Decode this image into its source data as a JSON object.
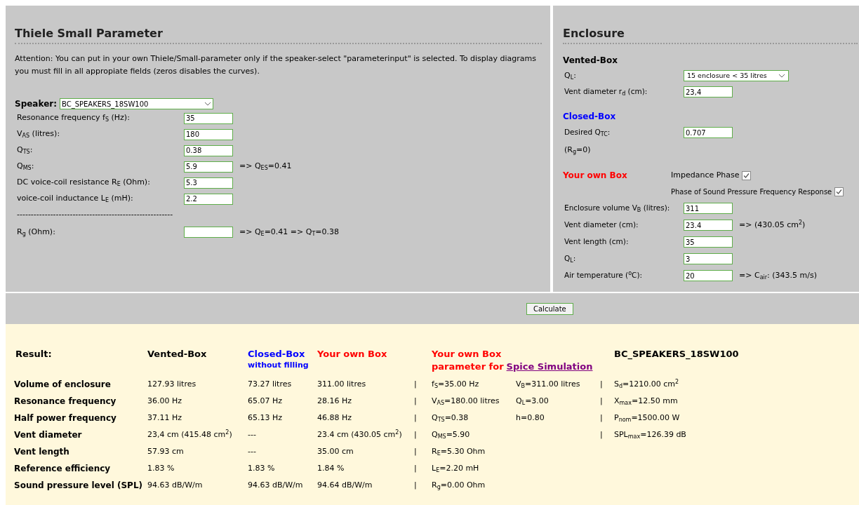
{
  "parameters": {
    "title": "Thiele Small Parameter",
    "notice": "Attention: You can put in your own Thiele/Small-parameter only if the speaker-select \"parameterinput\" is selected. To display diagrams you must fill in all appropiate fields (zeros disables the curves).",
    "speaker": {
      "label": "Speaker:",
      "value": "BC_SPEAKERS_18SW100"
    },
    "fields": [
      {
        "kind": "field",
        "label": "Resonance frequency f$_{S}$ (Hz):",
        "value": "35"
      },
      {
        "kind": "field",
        "label": "V$_{AS}$ (litres):",
        "value": "180"
      },
      {
        "kind": "field",
        "label": "Q$_{TS}$:",
        "value": "0.38"
      },
      {
        "kind": "field",
        "label": "Q$_{MS}$:",
        "value": "5.9",
        "note": "=> Q$_{ES}$=0.41"
      },
      {
        "kind": "field",
        "label": "DC voice-coil resistance R$_{E}$ (Ohm):",
        "value": "5.3"
      },
      {
        "kind": "field",
        "label": "voice-coil inductance L$_{E}$ (mH):",
        "value": "2.2"
      },
      {
        "kind": "divider",
        "text": "--------------------------------------------------------"
      },
      {
        "kind": "field",
        "label": "R$_{g}$ (Ohm):",
        "note": "=> Q$_{E}$=0.41 => Q$_{T}$=0.38"
      }
    ]
  },
  "enclosure": {
    "title": "Enclosure",
    "items": [
      {
        "kind": "heading",
        "text": "Vented-Box",
        "color": "#000000"
      },
      {
        "kind": "select",
        "label": "Q$_{L}$:",
        "value": "15 enclosure < 35 litres"
      },
      {
        "kind": "field",
        "label": "Vent diameter r$_{d}$ (cm):",
        "value": "23,4"
      },
      {
        "kind": "heading",
        "text": "Closed-Box",
        "color": "#0000ff"
      },
      {
        "kind": "field",
        "label": "Desired Q$_{TC}$:",
        "value": "0.707"
      },
      {
        "kind": "text",
        "text": "(R$_{g}$=0)"
      },
      {
        "kind": "heading",
        "text": "Your own Box",
        "color": "#ff0000",
        "check": {
          "label": "Impedance Phase",
          "checked": true
        }
      },
      {
        "kind": "check",
        "label": "Phase of Sound Pressure Frequency Response",
        "checked": true
      },
      {
        "kind": "field",
        "label": "Enclosure volume V$_{B}$ (litres):",
        "value": "311"
      },
      {
        "kind": "field",
        "label": "Vent diameter (cm):",
        "value": "23.4",
        "note": "=> (430.05 cm$^{2}$)"
      },
      {
        "kind": "field",
        "label": "Vent length (cm):",
        "value": "35"
      },
      {
        "kind": "field",
        "label": "Q$_{L}$:",
        "value": "3"
      },
      {
        "kind": "field",
        "label": "Air temperature ($^{o}$C):",
        "value": "20",
        "note": "=> C$_{air}$: (343.5 m/s)"
      }
    ]
  },
  "calculate_button": "Calculate",
  "results": {
    "header": {
      "label": "Result:",
      "vented": {
        "title": "Vented-Box"
      },
      "closed": {
        "title": "Closed-Box",
        "subtitle": "without filling",
        "color": "#0000ff"
      },
      "own": {
        "title": "Your own Box",
        "color": "#ff0000"
      },
      "spice": {
        "title": "Your own Box",
        "prefix": "parameter for",
        "link": "Spice Simulation",
        "color": "#ff0000"
      },
      "speaker": "BC_SPEAKERS_18SW100"
    },
    "rows": [
      {
        "label": "Volume of enclosure",
        "vented": "127.93 litres",
        "closed": "73.27 litres",
        "own": "311.00 litres",
        "sep_1": "|",
        "spice_1": "f$_{S}$=35.00 Hz",
        "spice_2": "V$_{B}$=311.00 litres",
        "sep_2": "|",
        "speaker": "S$_{d}$=1210.00 cm$^{2}$"
      },
      {
        "label": "Resonance frequency",
        "vented": "36.00 Hz",
        "closed": "65.07 Hz",
        "own": "28.16 Hz",
        "sep_1": "|",
        "spice_1": "V$_{AS}$=180.00 litres",
        "spice_2": "Q$_{L}$=3.00",
        "sep_2": "|",
        "speaker": "X$_{max}$=12.50 mm"
      },
      {
        "label": "Half power frequency",
        "vented": "37.11 Hz",
        "closed": "65.13 Hz",
        "own": "46.88 Hz",
        "sep_1": "|",
        "spice_1": "Q$_{TS}$=0.38",
        "spice_2": "h=0.80",
        "sep_2": "|",
        "speaker": "P$_{nom}$=1500.00 W"
      },
      {
        "label": "Vent diameter",
        "vented": "23,4 cm (415.48 cm$^{2}$)",
        "closed": "---",
        "own": "23.4 cm (430.05 cm$^{2}$)",
        "sep_1": "|",
        "spice_1": "Q$_{MS}$=5.90",
        "sep_2": "|",
        "speaker": "SPL$_{max}$=126.39 dB"
      },
      {
        "label": "Vent length",
        "vented": "57.93 cm",
        "closed": "---",
        "own": "35.00 cm",
        "sep_1": "|",
        "spice_1": "R$_{E}$=5.30 Ohm"
      },
      {
        "label": "Reference efficiency",
        "vented": "1.83 %",
        "closed": "1.83 %",
        "own": "1.84 %",
        "sep_1": "|",
        "spice_1": "L$_{E}$=2.20 mH"
      },
      {
        "label": "Sound pressure level (SPL)",
        "vented": "94.63 dB/W/m",
        "closed": "94.63 dB/W/m",
        "own": "94.64 dB/W/m",
        "sep_1": "|",
        "spice_1": "R$_{g}$=0.00 Ohm"
      }
    ]
  }
}
